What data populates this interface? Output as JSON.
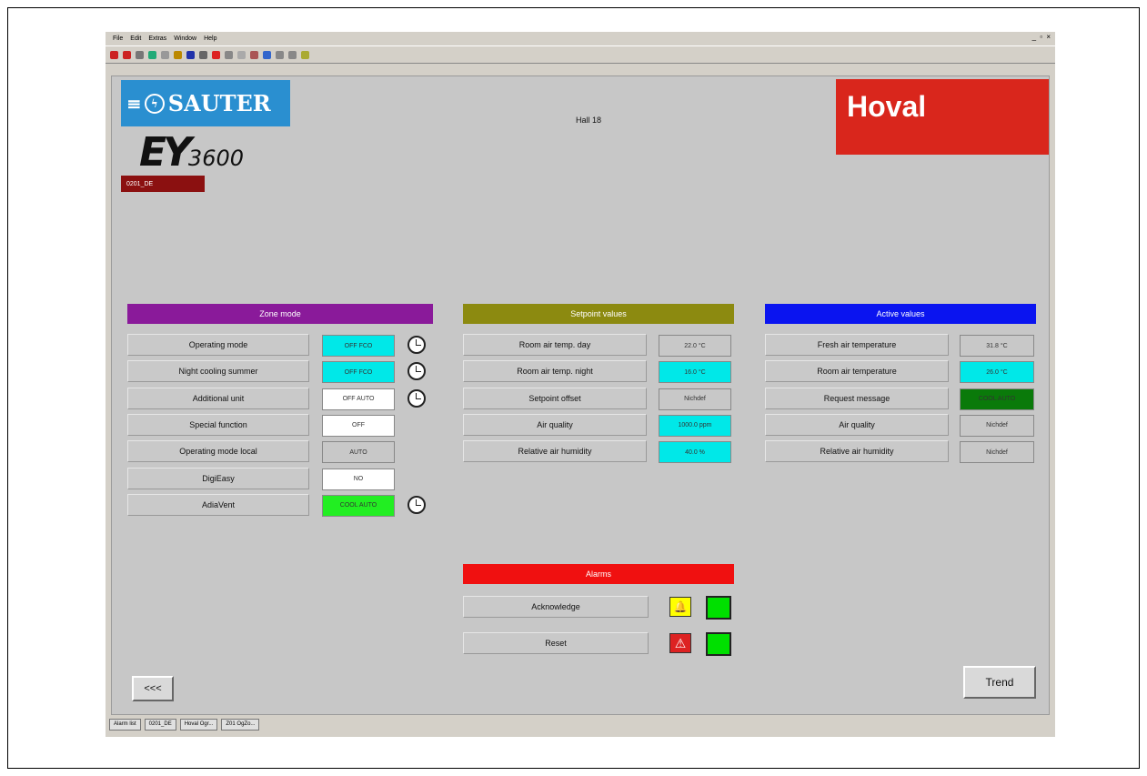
{
  "menu": [
    "File",
    "Edit",
    "Extras",
    "Window",
    "Help"
  ],
  "window_controls": "_ ▫ ×",
  "brand": {
    "sauter": "SAUTER",
    "ey_big": "EY",
    "ey_small": "3600",
    "hoval": "Hoval"
  },
  "object_tag": "0201_DE",
  "hall_title": "Hall 18",
  "zone_mode": {
    "header": "Zone mode",
    "rows": [
      {
        "label": "Operating mode",
        "value": "OFF FCO",
        "color": "#00e8e8",
        "clock": true
      },
      {
        "label": "Night cooling summer",
        "value": "OFF FCO",
        "color": "#00e8e8",
        "clock": true
      },
      {
        "label": "Additional unit",
        "value": "OFF AUTO",
        "color": "#ffffff",
        "clock": true
      },
      {
        "label": "Special function",
        "value": "OFF",
        "color": "#ffffff",
        "clock": false
      },
      {
        "label": "Operating mode local",
        "value": "AUTO",
        "color": "#c8c8c8",
        "clock": false
      },
      {
        "label": "DigiEasy",
        "value": "NO",
        "color": "#ffffff",
        "clock": false
      },
      {
        "label": "AdiaVent",
        "value": "COOL AUTO",
        "color": "#22ee22",
        "clock": true
      }
    ]
  },
  "setpoint": {
    "header": "Setpoint values",
    "rows": [
      {
        "label": "Room air temp. day",
        "value": "22.0 °C",
        "color": "#c8c8c8"
      },
      {
        "label": "Room air temp. night",
        "value": "16.0 °C",
        "color": "#00e8e8"
      },
      {
        "label": "Setpoint offset",
        "value": "Nichdef",
        "color": "#c8c8c8"
      },
      {
        "label": "Air quality",
        "value": "1000.0 ppm",
        "color": "#00e8e8"
      },
      {
        "label": "Relative air humidity",
        "value": "40.0 %",
        "color": "#00e8e8"
      }
    ]
  },
  "active": {
    "header": "Active values",
    "rows": [
      {
        "label": "Fresh air temperature",
        "value": "31.8 °C",
        "color": "#c8c8c8"
      },
      {
        "label": "Room air temperature",
        "value": "26.0 °C",
        "color": "#00e8e8"
      },
      {
        "label": "Request message",
        "value": "COOL AUTO",
        "color": "#0a7a0a"
      },
      {
        "label": "Air quality",
        "value": "Nichdef",
        "color": "#c8c8c8"
      },
      {
        "label": "Relative air humidity",
        "value": "Nichdef",
        "color": "#c8c8c8"
      }
    ]
  },
  "alarms": {
    "header": "Alarms",
    "acknowledge": "Acknowledge",
    "reset": "Reset"
  },
  "buttons": {
    "back": "<<<",
    "trend": "Trend"
  },
  "taskbar": [
    "Alarm list",
    "0201_DE",
    "Hoval Ogr...",
    "Z01 OgZo..."
  ],
  "colors": {
    "zone_header": "#8a1a9a",
    "setpoint_header": "#8c8a10",
    "active_header": "#0a14f0",
    "alarm_header": "#f01010"
  }
}
